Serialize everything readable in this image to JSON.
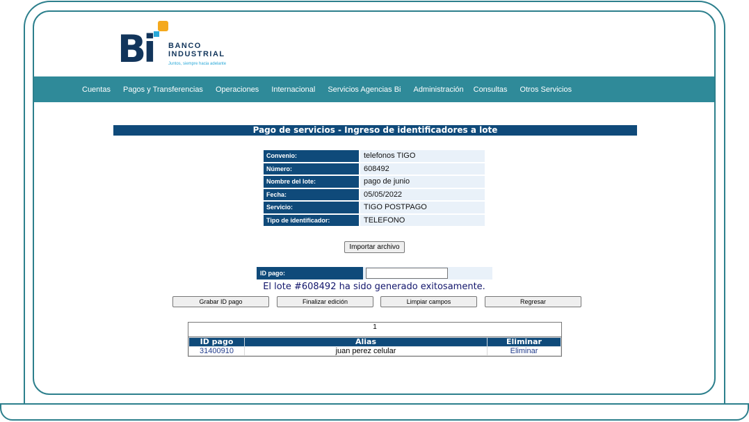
{
  "brand": {
    "logo_letters": "Bi",
    "name_line1": "BANCO",
    "name_line2": "INDUSTRIAL",
    "tagline": "Juntos, siempre hacia adelante"
  },
  "nav": {
    "items": [
      "Cuentas",
      "Pagos y Transferencias",
      "Operaciones",
      "Internacional",
      "Servicios Agencias Bi",
      "Administración",
      "Consultas",
      "Otros Servicios"
    ]
  },
  "page": {
    "title": "Pago de servicios - Ingreso de identificadores a lote"
  },
  "details": [
    {
      "label": "Convenio:",
      "value": "telefonos TIGO"
    },
    {
      "label": "Número:",
      "value": "608492"
    },
    {
      "label": "Nombre del lote:",
      "value": "pago de junio"
    },
    {
      "label": "Fecha:",
      "value": "05/05/2022"
    },
    {
      "label": "Servicio:",
      "value": "TIGO POSTPAGO"
    },
    {
      "label": "Tipo de identificador:",
      "value": "TELEFONO"
    }
  ],
  "import_button": "Importar archivo",
  "id_pago": {
    "label": "ID pago:",
    "value": ""
  },
  "message": "El lote #608492 ha sido generado exitosamente.",
  "actions": {
    "save": "Grabar ID pago",
    "finish": "Finalizar edición",
    "clear": "Limpiar campos",
    "back": "Regresar"
  },
  "results": {
    "page": "1",
    "columns": [
      "ID pago",
      "Alias",
      "Eliminar"
    ],
    "rows": [
      {
        "id": "31400910",
        "alias": "juan perez celular",
        "action": "Eliminar"
      }
    ]
  }
}
